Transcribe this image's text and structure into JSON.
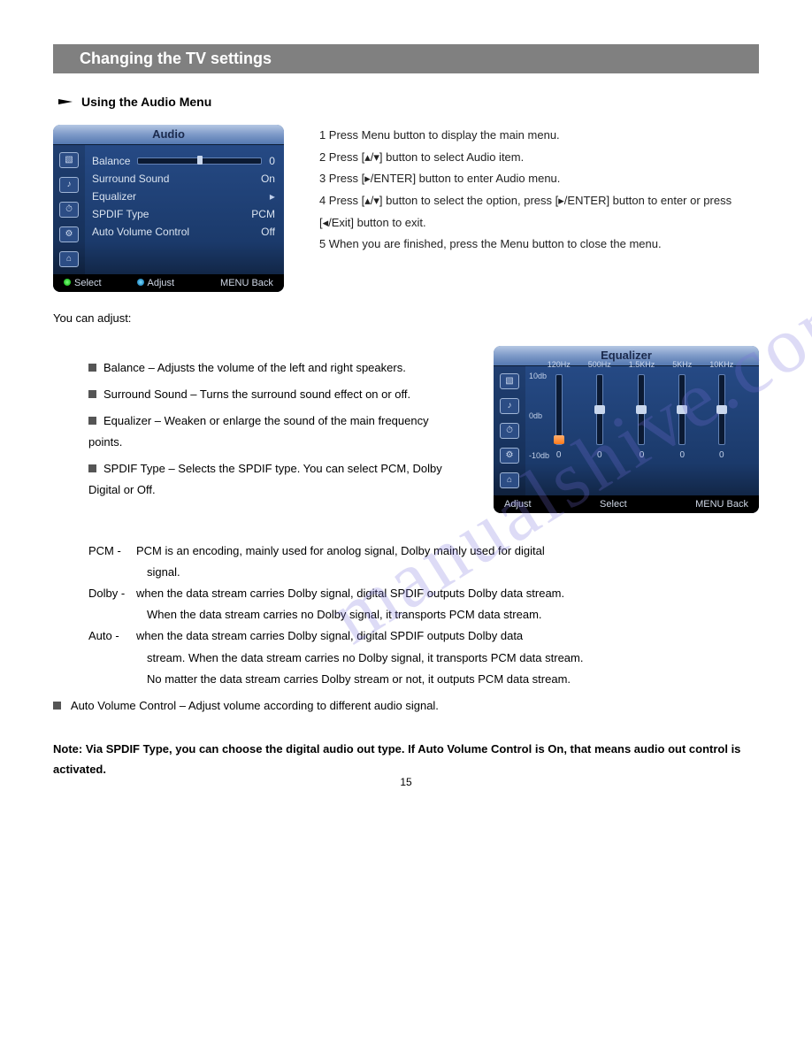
{
  "page": {
    "title": "Changing the TV settings",
    "section": "Using the Audio Menu",
    "number": "15"
  },
  "audio_osd": {
    "title": "Audio",
    "rows": {
      "balance": {
        "label": "Balance",
        "value": "0"
      },
      "surround": {
        "label": "Surround Sound",
        "value": "On"
      },
      "equalizer": {
        "label": "Equalizer",
        "value": "▸"
      },
      "spdif": {
        "label": "SPDIF Type",
        "value": "PCM"
      },
      "avc": {
        "label": "Auto Volume Control",
        "value": "Off"
      }
    },
    "footer": {
      "select": "Select",
      "adjust": "Adjust",
      "back": "MENU Back"
    }
  },
  "steps": {
    "s1": "1  Press Menu button to display the main menu.",
    "s2": "2  Press [▴/▾] button to select Audio item.",
    "s3": "3  Press [▸/ENTER] button to enter Audio menu.",
    "s4": "4  Press [▴/▾] button to select the option, press [▸/ENTER] button to enter or press [◂/Exit] button to exit.",
    "s5": "5  When you are finished, press the Menu button to close the menu."
  },
  "adjust_intro": "You can adjust:",
  "bullets": {
    "balance": "Balance – Adjusts the volume of the left and right speakers.",
    "surround": "Surround Sound – Turns the surround sound effect on or off.",
    "equalizer": "Equalizer – Weaken or enlarge the sound of the main frequency points.",
    "spdif": "SPDIF Type – Selects the SPDIF type.  You can select PCM,  Dolby Digital or Off."
  },
  "eq_osd": {
    "title": "Equalizer",
    "labels": {
      "top": "10db",
      "mid": "0db",
      "bot": "-10db"
    },
    "cols": [
      {
        "freq": "120Hz",
        "val": "0",
        "pos": 78,
        "orange": true
      },
      {
        "freq": "500Hz",
        "val": "0",
        "pos": 38
      },
      {
        "freq": "1.5KHz",
        "val": "0",
        "pos": 38
      },
      {
        "freq": "5KHz",
        "val": "0",
        "pos": 38
      },
      {
        "freq": "10KHz",
        "val": "0",
        "pos": 38
      }
    ],
    "footer": {
      "adjust": "Adjust",
      "select": "Select",
      "back": "MENU Back"
    }
  },
  "spdif_detail": {
    "pcm_term": "PCM -",
    "pcm_text1": "PCM is an encoding,  mainly used for anolog signal,  Dolby mainly used for digital",
    "pcm_text2": "signal.",
    "dolby_term": "Dolby -",
    "dolby_text1": "when the data stream carries Dolby signal, digital SPDIF outputs Dolby data stream.",
    "dolby_text2": "When the data stream carries no Dolby signal, it transports PCM data stream.",
    "auto_term": "Auto -",
    "auto_text1": "when the data stream carries Dolby signal, digital SPDIF outputs Dolby data",
    "auto_text2": "stream. When the data stream carries no Dolby signal, it transports PCM data stream.",
    "auto_text3": "No matter the data stream carries Dolby stream or not, it outputs PCM data stream."
  },
  "avc_line": "Auto Volume Control  –  Adjust volume according to different audio signal.",
  "note": "Note:  Via SPDIF Type,  you can choose the digital audio out type.  If Auto Volume Control is On,  that means audio out control is activated.",
  "watermark": "manualshive.com"
}
